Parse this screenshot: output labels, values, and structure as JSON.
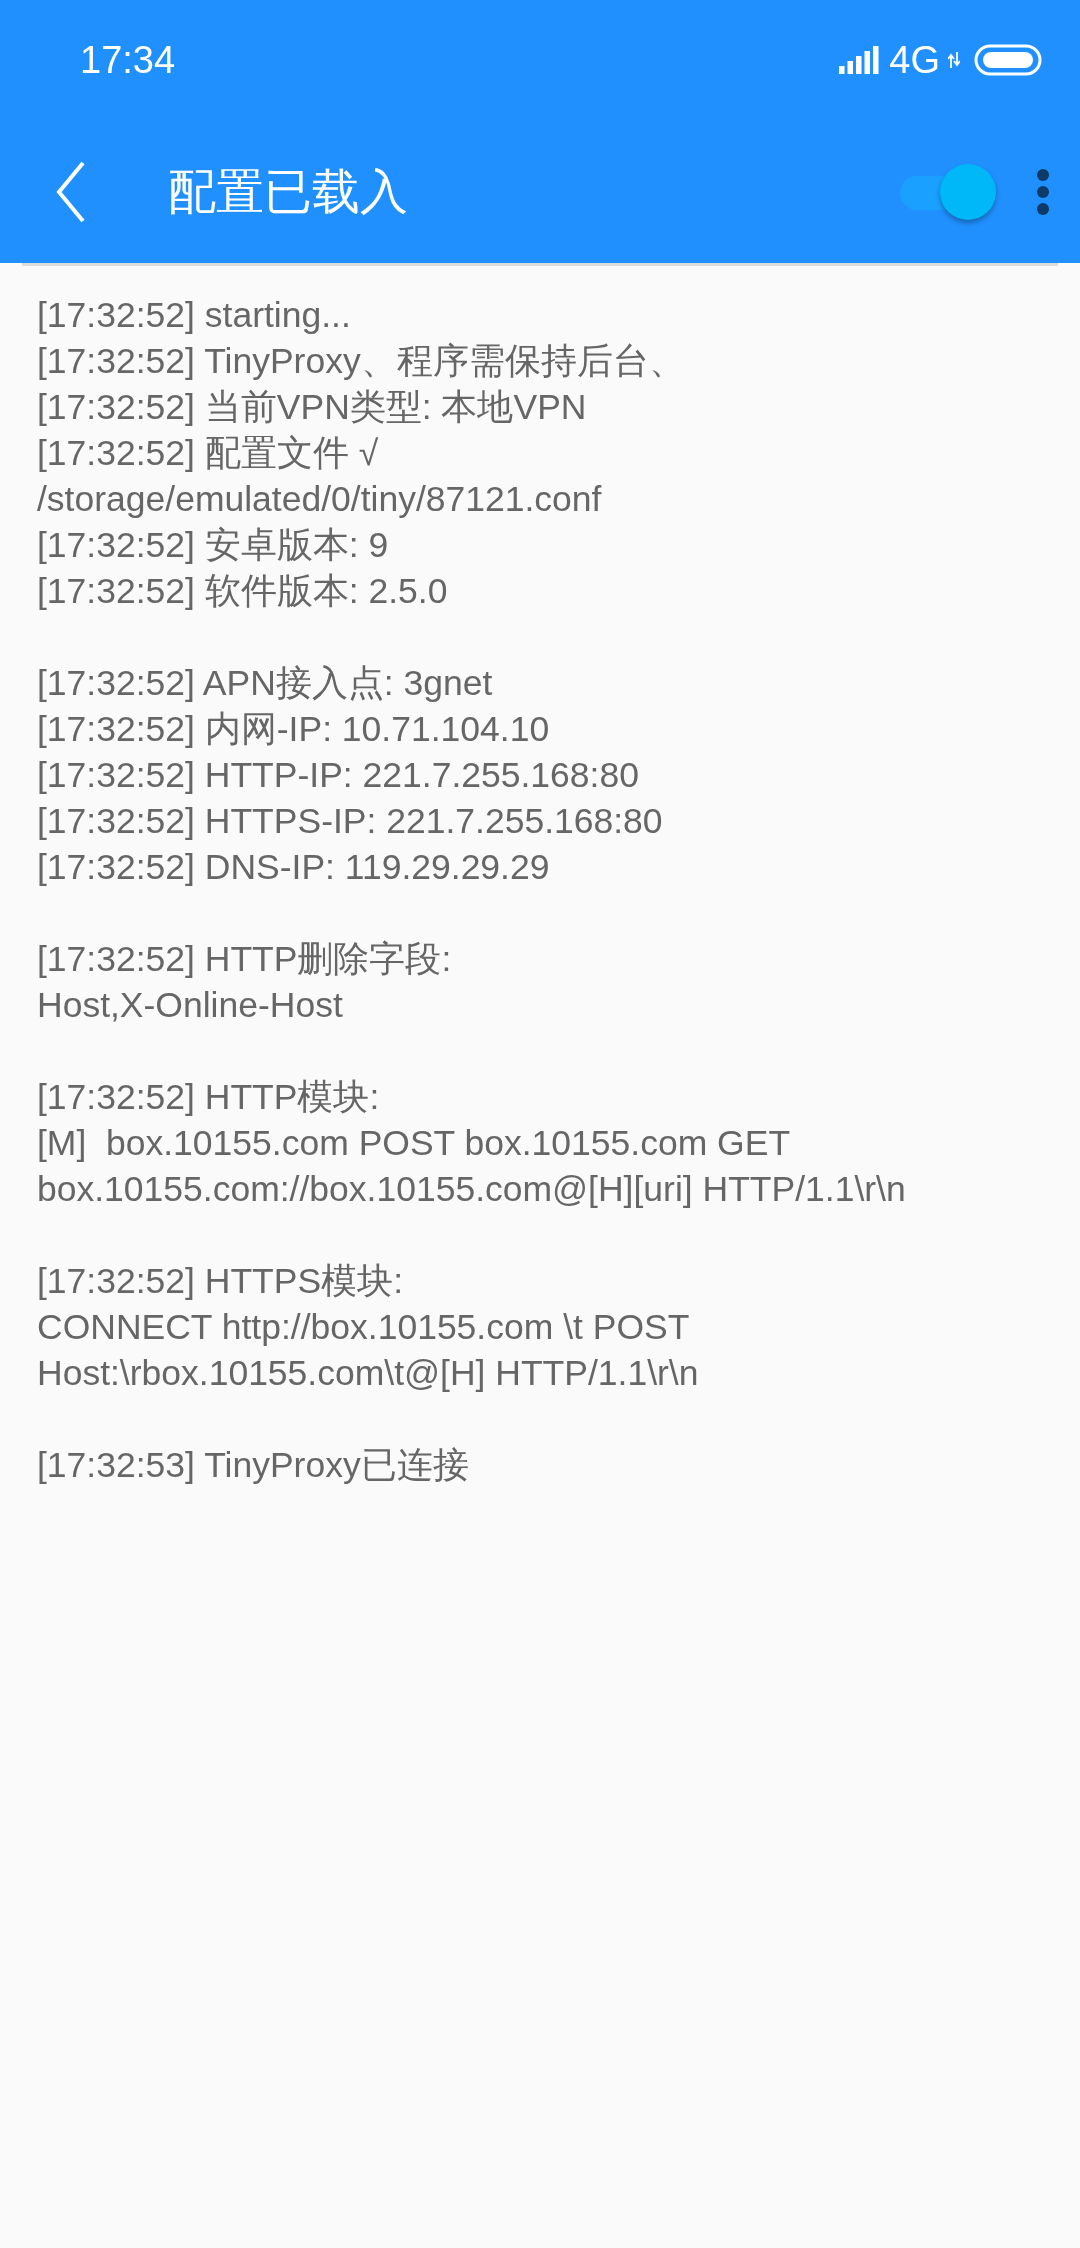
{
  "status_bar": {
    "time": "17:34",
    "network": "4G"
  },
  "toolbar": {
    "title": "配置已载入",
    "switch": {
      "on": true
    }
  },
  "log": [
    [
      "[17:32:52] starting...",
      "[17:32:52] TinyProxy、程序需保持后台、",
      "[17:32:52] 当前VPN类型: 本地VPN",
      "[17:32:52] 配置文件 √",
      "/storage/emulated/0/tiny/87121.conf",
      "[17:32:52] 安卓版本: 9",
      "[17:32:52] 软件版本: 2.5.0"
    ],
    [
      "[17:32:52] APN接入点: 3gnet",
      "[17:32:52] 内网-IP: 10.71.104.10",
      "[17:32:52] HTTP-IP: 221.7.255.168:80",
      "[17:32:52] HTTPS-IP: 221.7.255.168:80",
      "[17:32:52] DNS-IP: 119.29.29.29"
    ],
    [
      "[17:32:52] HTTP删除字段:",
      "Host,X-Online-Host"
    ],
    [
      "[17:32:52] HTTP模块:",
      "[M]  box.10155.com POST box.10155.com GET",
      "box.10155.com://box.10155.com@[H][uri] HTTP/1.1\\r\\n"
    ],
    [
      "[17:32:52] HTTPS模块:",
      "CONNECT http://box.10155.com \\t POST",
      "Host:\\rbox.10155.com\\t@[H] HTTP/1.1\\r\\n"
    ],
    [
      "[17:32:53] TinyProxy已连接"
    ]
  ]
}
